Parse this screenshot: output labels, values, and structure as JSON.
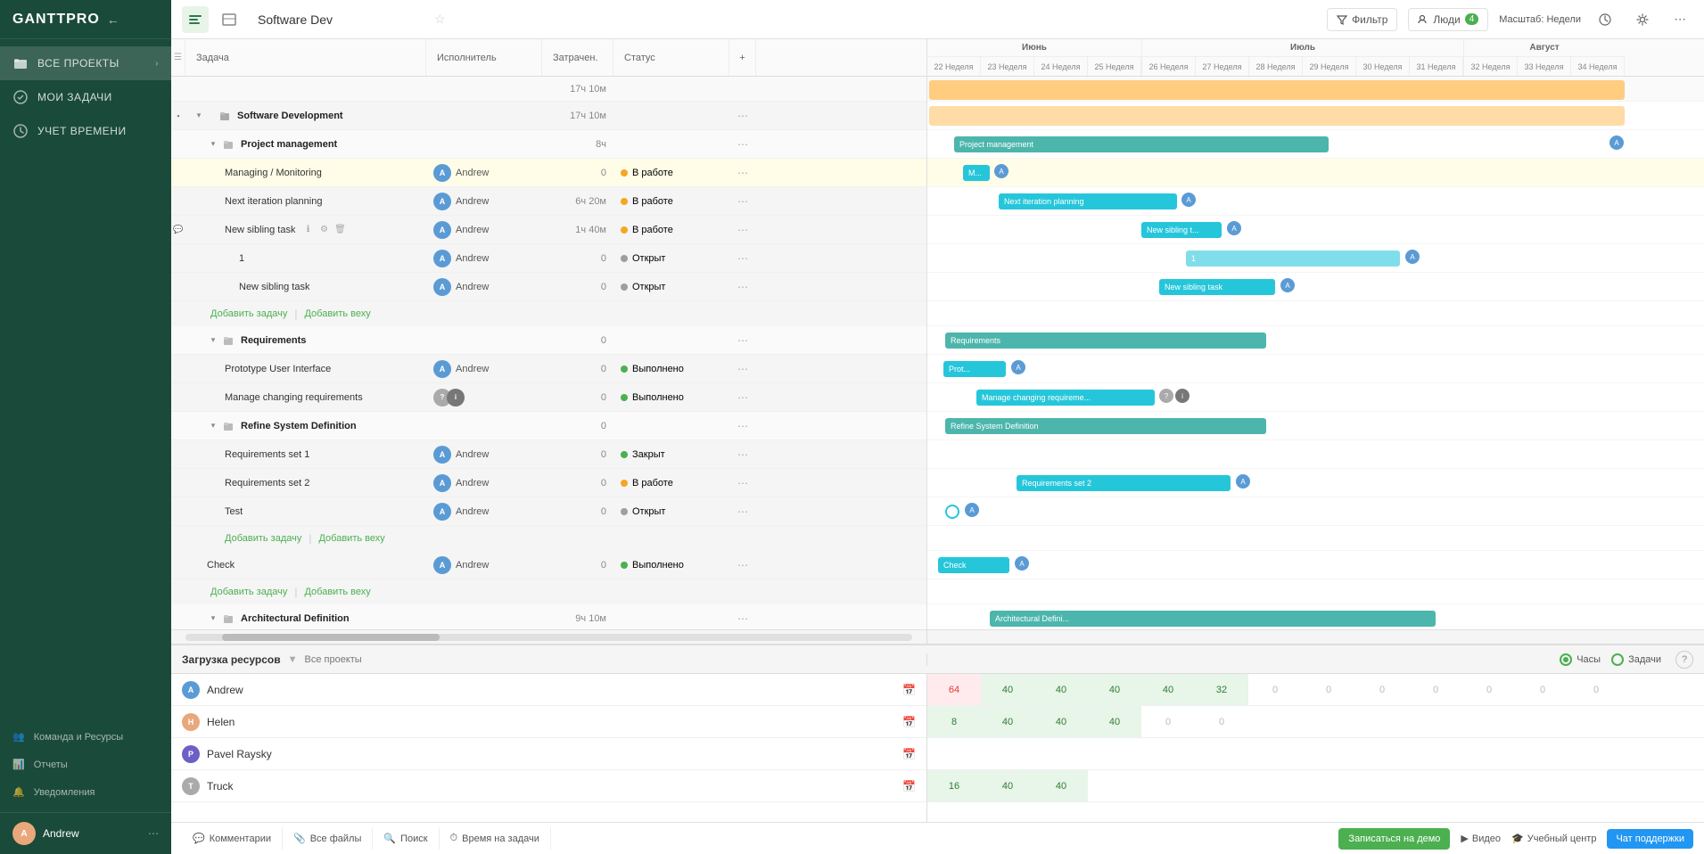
{
  "app": {
    "logo": "GANTTPRO",
    "back_icon": "←"
  },
  "sidebar": {
    "items": [
      {
        "id": "all-projects",
        "label": "ВСЕ ПРОЕКТЫ",
        "icon": "folder",
        "has_chevron": true
      },
      {
        "id": "my-tasks",
        "label": "МОИ ЗАДАЧИ",
        "icon": "check"
      },
      {
        "id": "time-tracking",
        "label": "УЧЕТ ВРЕМЕНИ",
        "icon": "clock"
      }
    ],
    "bottom_items": [
      {
        "id": "team",
        "label": "Команда и Ресурсы",
        "icon": "users"
      },
      {
        "id": "reports",
        "label": "Отчеты",
        "icon": "chart"
      },
      {
        "id": "notifications",
        "label": "Уведомления",
        "icon": "bell"
      }
    ],
    "user": {
      "name": "Andrew",
      "avatar": "A"
    }
  },
  "topbar": {
    "view_gantt_label": "gantt",
    "view_list_label": "list",
    "project_title": "Software Dev",
    "filter_label": "Фильтр",
    "people_label": "Люди",
    "people_count": "4",
    "scale_label": "Масштаб: Недели",
    "more_label": "..."
  },
  "task_panel": {
    "headers": {
      "task": "Задача",
      "assignee": "Исполнитель",
      "spent": "Затрачен.",
      "status": "Статус"
    },
    "total_spent": "17ч 10м",
    "rows": [
      {
        "id": "software-dev",
        "level": 0,
        "name": "Software Development",
        "spent": "17ч 10м",
        "is_group": true,
        "collapse": true
      },
      {
        "id": "project-mgmt",
        "level": 1,
        "name": "Project management",
        "spent": "8ч",
        "is_group": true,
        "collapse": true
      },
      {
        "id": "managing",
        "level": 2,
        "name": "Managing / Monitoring",
        "assignee": "Andrew",
        "av_class": "av-andrew",
        "spent": "0",
        "status": "В работе",
        "status_type": "in-progress",
        "highlighted": true
      },
      {
        "id": "next-iter",
        "level": 2,
        "name": "Next iteration planning",
        "assignee": "Andrew",
        "av_class": "av-andrew",
        "spent": "6ч 20м",
        "status": "В работе",
        "status_type": "in-progress"
      },
      {
        "id": "new-sibling",
        "level": 2,
        "name": "New sibling task",
        "assignee": "Andrew",
        "av_class": "av-andrew",
        "spent": "1ч 40м",
        "status": "В работе",
        "status_type": "in-progress",
        "has_comment": true,
        "has_icons": true
      },
      {
        "id": "task-1",
        "level": 3,
        "name": "1",
        "assignee": "Andrew",
        "av_class": "av-andrew",
        "spent": "0",
        "status": "Открыт",
        "status_type": "open"
      },
      {
        "id": "new-sibling2",
        "level": 3,
        "name": "New sibling task",
        "assignee": "Andrew",
        "av_class": "av-andrew",
        "spent": "0",
        "status": "Открыт",
        "status_type": "open"
      },
      {
        "id": "add-row-1",
        "type": "add",
        "level": 2,
        "add_task": "Добавить задачу",
        "add_milestone": "Добавить веху"
      },
      {
        "id": "requirements",
        "level": 1,
        "name": "Requirements",
        "spent": "0",
        "is_group": true,
        "collapse": true
      },
      {
        "id": "prototype-ui",
        "level": 2,
        "name": "Prototype User Interface",
        "assignee": "Andrew",
        "av_class": "av-andrew",
        "spent": "0",
        "status": "Выполнено",
        "status_type": "done"
      },
      {
        "id": "manage-req",
        "level": 2,
        "name": "Manage changing requirements",
        "assignee": "",
        "av_class": "",
        "spent": "0",
        "status": "Выполнено",
        "status_type": "done"
      },
      {
        "id": "refine-sys",
        "level": 1,
        "name": "Refine System Definition",
        "spent": "0",
        "is_group": true,
        "collapse": true
      },
      {
        "id": "req-set-1",
        "level": 2,
        "name": "Requirements set 1",
        "assignee": "Andrew",
        "av_class": "av-andrew",
        "spent": "0",
        "status": "Закрыт",
        "status_type": "closed"
      },
      {
        "id": "req-set-2",
        "level": 2,
        "name": "Requirements set 2",
        "assignee": "Andrew",
        "av_class": "av-andrew",
        "spent": "0",
        "status": "В работе",
        "status_type": "in-progress"
      },
      {
        "id": "test",
        "level": 2,
        "name": "Test",
        "assignee": "Andrew",
        "av_class": "av-andrew",
        "spent": "0",
        "status": "Открыт",
        "status_type": "open"
      },
      {
        "id": "add-row-2",
        "type": "add",
        "level": 2,
        "add_task": "Добавить задачу",
        "add_milestone": "Добавить веху"
      },
      {
        "id": "check",
        "level": 1,
        "name": "Check",
        "assignee": "Andrew",
        "av_class": "av-andrew",
        "spent": "0",
        "status": "Выполнено",
        "status_type": "done"
      },
      {
        "id": "add-row-3",
        "type": "add",
        "level": 1,
        "add_task": "Добавить задачу",
        "add_milestone": "Добавить веху"
      },
      {
        "id": "arch-def",
        "level": 1,
        "name": "Architectural Definition",
        "spent": "9ч 10м",
        "is_group": true,
        "collapse": true
      }
    ]
  },
  "gantt_header": {
    "months": [
      {
        "label": "Июнь",
        "weeks": [
          "22 Неделя",
          "23 Неделя",
          "24 Неделя",
          "25 Неделя"
        ]
      },
      {
        "label": "Июль",
        "weeks": [
          "26 Неделя",
          "27 Неделя",
          "28 Неделя",
          "29 Неделя",
          "30 Неделя",
          "31 Неделя"
        ]
      },
      {
        "label": "Август",
        "weeks": [
          "32 Неделя",
          "33 Неделя",
          "34 Неделя"
        ]
      }
    ]
  },
  "resource_panel": {
    "title": "Загрузка ресурсов",
    "all_projects": "Все проекты",
    "radio_hours": "Часы",
    "radio_tasks": "Задачи",
    "users": [
      {
        "name": "Andrew",
        "av_class": "av-andrew",
        "av_letter": "A"
      },
      {
        "name": "Helen",
        "av_class": "av-helen",
        "av_letter": "H"
      },
      {
        "name": "Pavel Raysky",
        "av_class": "av-pavel",
        "av_letter": "P"
      },
      {
        "name": "Truck",
        "av_class": "av-truck",
        "av_letter": "T"
      }
    ],
    "data": [
      {
        "user": "Andrew",
        "cells": [
          "64",
          "40",
          "40",
          "40",
          "40",
          "32",
          "0",
          "0",
          "0",
          "0",
          "0",
          "0",
          "0"
        ]
      },
      {
        "user": "Helen",
        "cells": [
          "8",
          "40",
          "40",
          "40",
          "0",
          "0",
          "",
          "",
          "",
          "",
          "",
          "",
          ""
        ]
      },
      {
        "user": "Pavel Raysky",
        "cells": [
          "",
          "",
          "",
          "",
          "",
          "",
          "",
          "",
          "",
          "",
          "",
          "",
          ""
        ]
      },
      {
        "user": "Truck",
        "cells": [
          "16",
          "40",
          "40",
          "",
          "",
          "",
          "",
          "",
          "",
          "",
          "",
          "",
          ""
        ]
      }
    ]
  },
  "bottom_bar": {
    "tabs": [
      {
        "label": "Комментарии",
        "icon": "💬"
      },
      {
        "label": "Все файлы",
        "icon": "📎"
      },
      {
        "label": "Поиск",
        "icon": "🔍"
      },
      {
        "label": "Время на задачи",
        "icon": "⏱"
      }
    ],
    "demo_btn": "Записаться на демо",
    "video_btn": "Видео",
    "education_btn": "Учебный центр",
    "chat_btn": "Чат поддержки"
  }
}
